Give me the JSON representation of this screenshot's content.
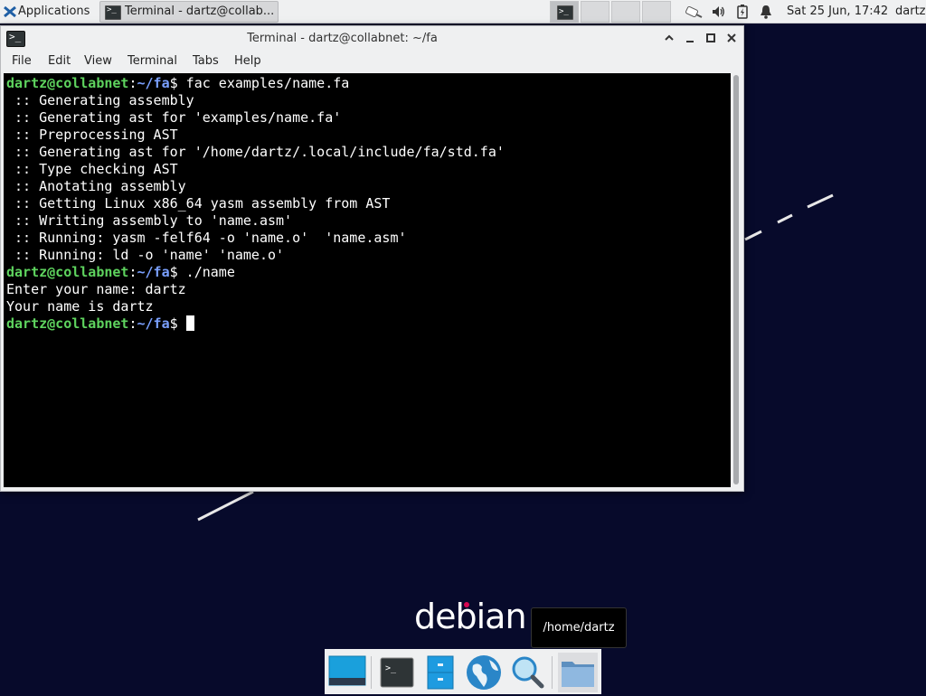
{
  "panel": {
    "applications_label": "Applications",
    "task_label": "Terminal - dartz@collab...",
    "clock": "Sat 25 Jun, 17:42",
    "user": "dartz"
  },
  "window": {
    "title": "Terminal - dartz@collabnet: ~/fa",
    "menu": [
      "File",
      "Edit",
      "View",
      "Terminal",
      "Tabs",
      "Help"
    ]
  },
  "terminal": {
    "prompt_user": "dartz@collabnet",
    "prompt_path": "~/fa",
    "lines": [
      {
        "type": "prompt",
        "cmd": " fac examples/name.fa"
      },
      {
        "type": "out",
        "text": " :: Generating assembly"
      },
      {
        "type": "out",
        "text": " :: Generating ast for 'examples/name.fa'"
      },
      {
        "type": "out",
        "text": " :: Preprocessing AST"
      },
      {
        "type": "out",
        "text": " :: Generating ast for '/home/dartz/.local/include/fa/std.fa'"
      },
      {
        "type": "out",
        "text": " :: Type checking AST"
      },
      {
        "type": "out",
        "text": " :: Anotating assembly"
      },
      {
        "type": "out",
        "text": " :: Getting Linux x86_64 yasm assembly from AST"
      },
      {
        "type": "out",
        "text": " :: Writting assembly to 'name.asm'"
      },
      {
        "type": "out",
        "text": " :: Running: yasm -felf64 -o 'name.o'  'name.asm'"
      },
      {
        "type": "out",
        "text": " :: Running: ld -o 'name' 'name.o'"
      },
      {
        "type": "prompt",
        "cmd": " ./name"
      },
      {
        "type": "out",
        "text": "Enter your name: dartz"
      },
      {
        "type": "out",
        "text": "Your name is dartz"
      },
      {
        "type": "prompt",
        "cmd": " ",
        "cursor": true
      }
    ]
  },
  "desktop": {
    "logo_text": "debian",
    "tooltip": "/home/dartz"
  },
  "dock": {
    "items": [
      "show-desktop-icon",
      "terminal-icon",
      "file-cabinet-icon",
      "web-browser-icon",
      "search-icon",
      "folder-icon"
    ]
  }
}
